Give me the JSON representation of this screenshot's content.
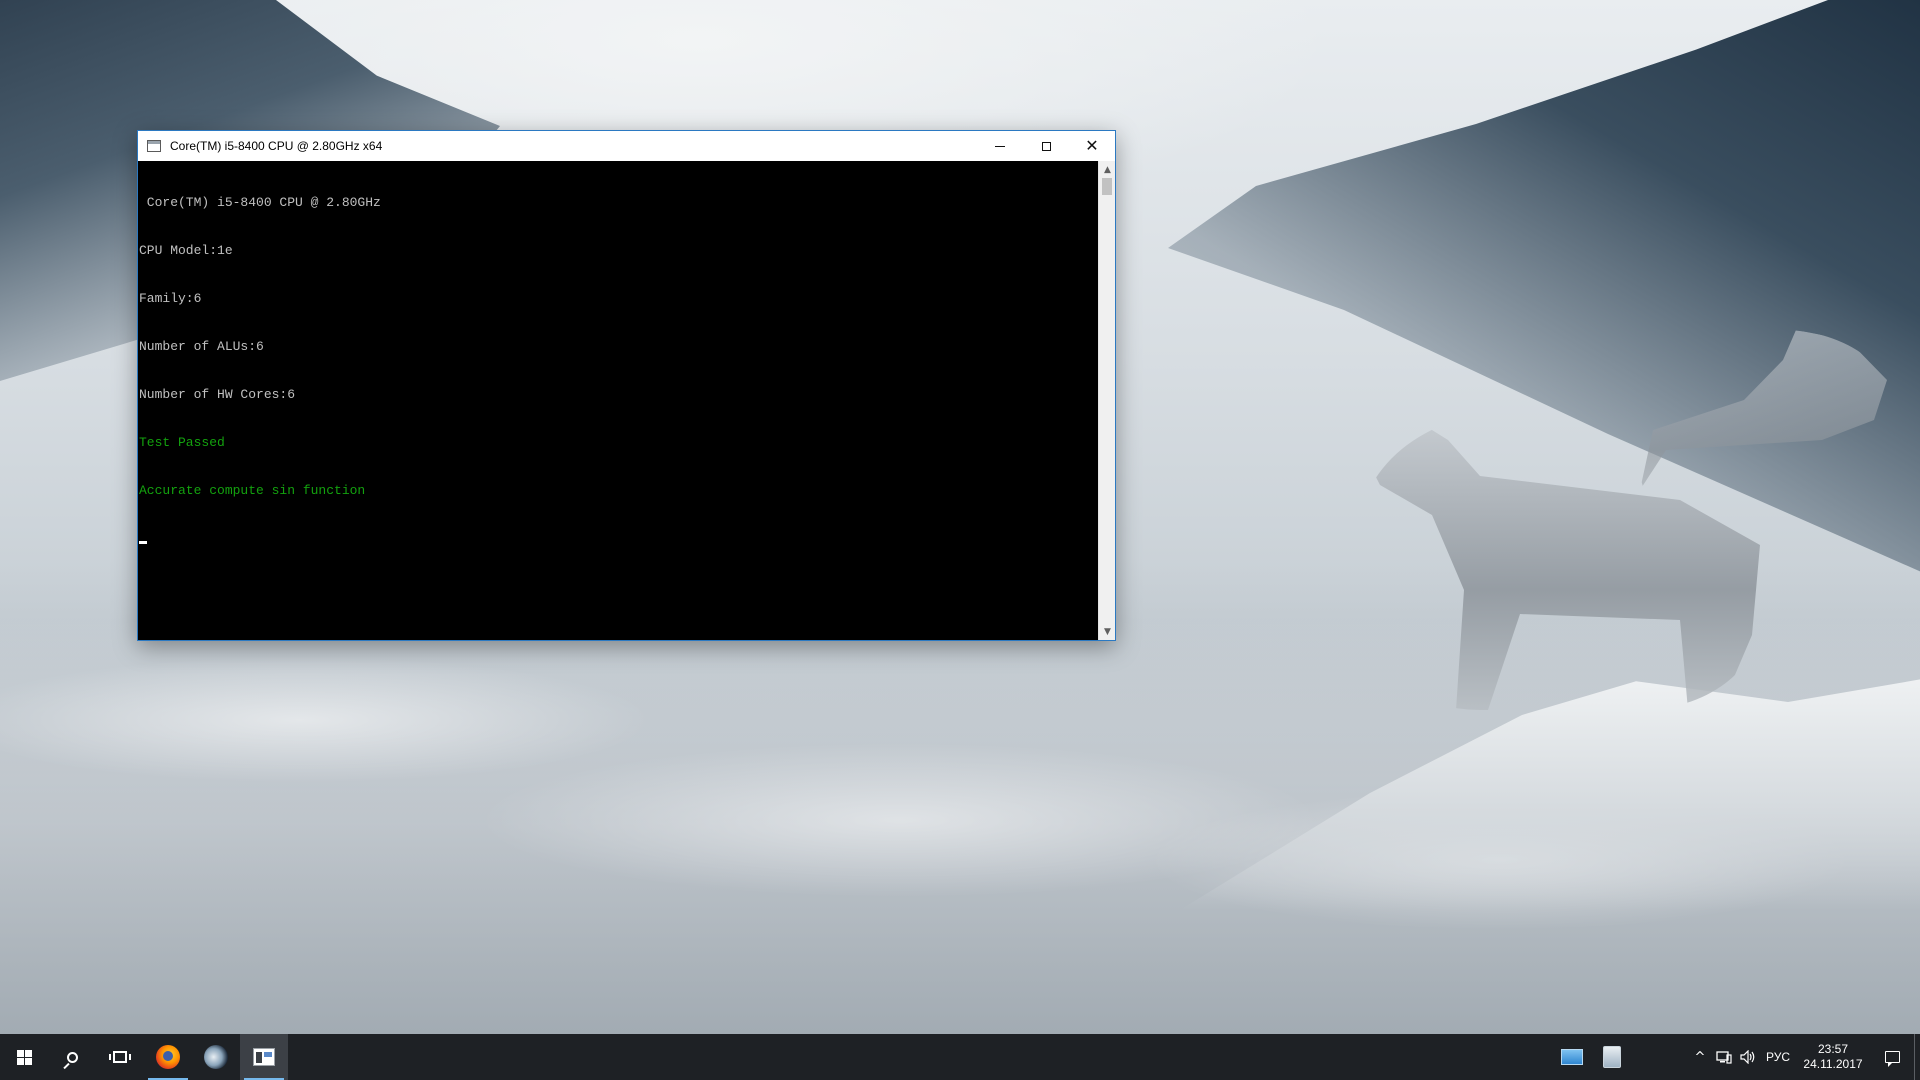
{
  "window": {
    "title": "Core(TM) i5-8400 CPU @ 2.80GHz x64",
    "controls": {
      "minimize": "minimize",
      "maximize": "maximize",
      "close": "✕"
    }
  },
  "console": {
    "lines": [
      {
        "text": " Core(TM) i5-8400 CPU @ 2.80GHz",
        "color": "#c0c0c0"
      },
      {
        "text": "CPU Model:1e",
        "color": "#c0c0c0"
      },
      {
        "text": "Family:6",
        "color": "#c0c0c0"
      },
      {
        "text": "Number of ALUs:6",
        "color": "#c0c0c0"
      },
      {
        "text": "Number of HW Cores:6",
        "color": "#c0c0c0"
      },
      {
        "text": "Test Passed",
        "color": "#13a10e"
      },
      {
        "text": "Accurate compute sin function",
        "color": "#13a10e"
      }
    ]
  },
  "taskbar": {
    "buttons": [
      {
        "name": "start-button",
        "icon": "windows-logo-icon"
      },
      {
        "name": "search-button",
        "icon": "search-icon"
      },
      {
        "name": "task-view-button",
        "icon": "task-view-icon"
      },
      {
        "name": "firefox-taskbar-button",
        "icon": "firefox-icon",
        "running": true
      },
      {
        "name": "steam-taskbar-button",
        "icon": "steam-icon"
      },
      {
        "name": "console-taskbar-button",
        "icon": "console-icon",
        "running": true,
        "active": true
      }
    ],
    "tray": {
      "chevron": "^",
      "language": "РУС",
      "time": "23:57",
      "date": "24.11.2017"
    }
  },
  "colors": {
    "accent": "#2b79c2",
    "taskbar": "#1e2125",
    "console_bg": "#000000",
    "console_text": "#c0c0c0",
    "console_green": "#13a10e"
  }
}
